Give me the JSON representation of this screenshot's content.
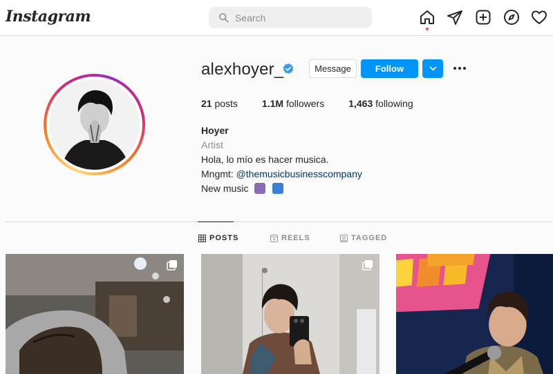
{
  "nav": {
    "logo": "Instagram",
    "search_placeholder": "Search",
    "icons": [
      "home-icon",
      "direct-icon",
      "new-post-icon",
      "explore-icon",
      "activity-icon"
    ]
  },
  "profile": {
    "username": "alexhoyer_",
    "verified": true,
    "buttons": {
      "message": "Message",
      "follow": "Follow"
    },
    "stats": {
      "posts_value": "21",
      "posts_label": "posts",
      "followers_value": "1.1M",
      "followers_label": "followers",
      "following_value": "1,463",
      "following_label": "following"
    },
    "bio": {
      "name": "Hoyer",
      "category": "Artist",
      "line1": "Hola, lo mío es hacer musica.",
      "line2_prefix": "Mngmt: ",
      "line2_link": "@themusicbusinesscompany",
      "line3": "New music"
    }
  },
  "tabs": [
    {
      "label": "POSTS",
      "active": true
    },
    {
      "label": "REELS",
      "active": false
    },
    {
      "label": "TAGGED",
      "active": false
    }
  ],
  "colors": {
    "accent": "#0095f6",
    "verified": "#3897f0",
    "notification": "#ed4956"
  }
}
